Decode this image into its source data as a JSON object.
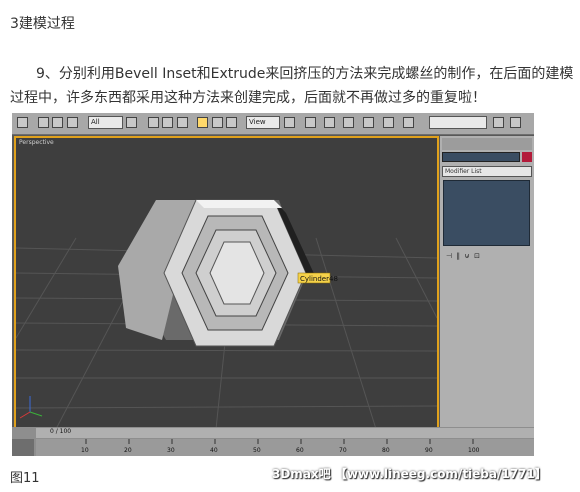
{
  "heading": "3建模过程",
  "paragraph": "9、分别利用Bevell Inset和Extrude来回挤压的方法来完成螺丝的制作，在后面的建模过程中，许多东西都采用这种方法来创建完成，后面就不再做过多的重复啦！",
  "screenshot": {
    "toolbar": {
      "selection_filter": "All",
      "ref_coord": "View"
    },
    "viewport": {
      "label": "Perspective",
      "tooltip": "Cylinder48"
    },
    "panel": {
      "modifier_list": "Modifier List"
    },
    "timeline": {
      "frame_counter": "0 / 100",
      "ticks": [
        "10",
        "20",
        "30",
        "40",
        "50",
        "60",
        "70",
        "80",
        "90",
        "100"
      ]
    }
  },
  "caption": "图11",
  "watermark": "3Dmax吧 【www.lineeg.com/tieba/1771】",
  "colors": {
    "viewport_border": "#e0a11c",
    "tooltip_bg": "#f5d24a",
    "modifier_box": "#3a4d62"
  }
}
